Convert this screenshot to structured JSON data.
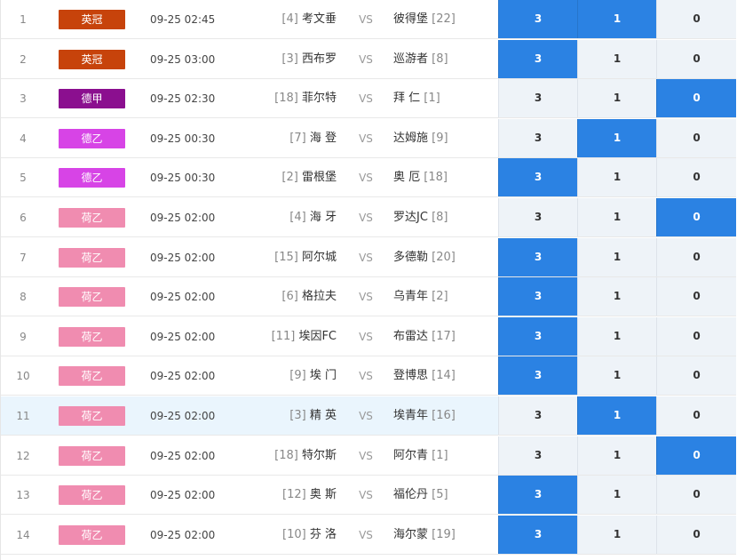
{
  "vs_label": "VS",
  "colors": {
    "英冠": "#c7430b",
    "德甲": "#8b0f8f",
    "德乙": "#d744e6",
    "荷乙": "#f08cb0",
    "selected": "#2b82e3"
  },
  "options": [
    "3",
    "1",
    "0"
  ],
  "matches": [
    {
      "num": "1",
      "league": "英冠",
      "time": "09-25 02:45",
      "home_rank": "[4]",
      "home": "考文垂",
      "away": "彼得堡",
      "away_rank": "[22]",
      "selected": [
        "3",
        "1"
      ]
    },
    {
      "num": "2",
      "league": "英冠",
      "time": "09-25 03:00",
      "home_rank": "[3]",
      "home": "西布罗",
      "away": "巡游者",
      "away_rank": "[8]",
      "selected": [
        "3"
      ]
    },
    {
      "num": "3",
      "league": "德甲",
      "time": "09-25 02:30",
      "home_rank": "[18]",
      "home": "菲尔特",
      "away": "拜 仁",
      "away_rank": "[1]",
      "selected": [
        "0"
      ]
    },
    {
      "num": "4",
      "league": "德乙",
      "time": "09-25 00:30",
      "home_rank": "[7]",
      "home": "海 登",
      "away": "达姆施",
      "away_rank": "[9]",
      "selected": [
        "1"
      ]
    },
    {
      "num": "5",
      "league": "德乙",
      "time": "09-25 00:30",
      "home_rank": "[2]",
      "home": "雷根堡",
      "away": "奥 厄",
      "away_rank": "[18]",
      "selected": [
        "3"
      ]
    },
    {
      "num": "6",
      "league": "荷乙",
      "time": "09-25 02:00",
      "home_rank": "[4]",
      "home": "海 牙",
      "away": "罗达JC",
      "away_rank": "[8]",
      "selected": [
        "0"
      ]
    },
    {
      "num": "7",
      "league": "荷乙",
      "time": "09-25 02:00",
      "home_rank": "[15]",
      "home": "阿尔城",
      "away": "多德勒",
      "away_rank": "[20]",
      "selected": [
        "3"
      ]
    },
    {
      "num": "8",
      "league": "荷乙",
      "time": "09-25 02:00",
      "home_rank": "[6]",
      "home": "格拉夫",
      "away": "乌青年",
      "away_rank": "[2]",
      "selected": [
        "3"
      ]
    },
    {
      "num": "9",
      "league": "荷乙",
      "time": "09-25 02:00",
      "home_rank": "[11]",
      "home": "埃因FC",
      "away": "布雷达",
      "away_rank": "[17]",
      "selected": [
        "3"
      ]
    },
    {
      "num": "10",
      "league": "荷乙",
      "time": "09-25 02:00",
      "home_rank": "[9]",
      "home": "埃 门",
      "away": "登博思",
      "away_rank": "[14]",
      "selected": [
        "3"
      ]
    },
    {
      "num": "11",
      "league": "荷乙",
      "time": "09-25 02:00",
      "home_rank": "[3]",
      "home": "精 英",
      "away": "埃青年",
      "away_rank": "[16]",
      "selected": [
        "1"
      ],
      "highlight": true
    },
    {
      "num": "12",
      "league": "荷乙",
      "time": "09-25 02:00",
      "home_rank": "[18]",
      "home": "特尔斯",
      "away": "阿尔青",
      "away_rank": "[1]",
      "selected": [
        "0"
      ]
    },
    {
      "num": "13",
      "league": "荷乙",
      "time": "09-25 02:00",
      "home_rank": "[12]",
      "home": "奥 斯",
      "away": "福伦丹",
      "away_rank": "[5]",
      "selected": [
        "3"
      ]
    },
    {
      "num": "14",
      "league": "荷乙",
      "time": "09-25 02:00",
      "home_rank": "[10]",
      "home": "芬 洛",
      "away": "海尔蒙",
      "away_rank": "[19]",
      "selected": [
        "3"
      ]
    }
  ]
}
